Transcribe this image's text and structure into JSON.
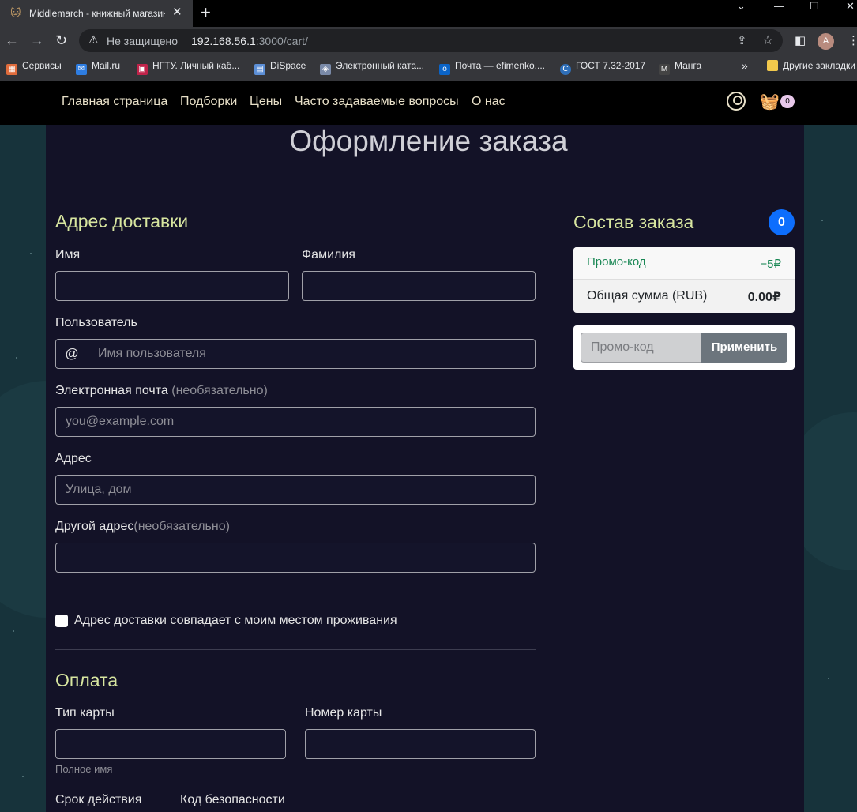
{
  "browser": {
    "tab_title": "Middlemarch - книжный магазин",
    "security_text": "Не защищено",
    "url_host": "192.168.56.1",
    "url_path": ":3000/cart/",
    "avatar_letter": "A",
    "bookmarks": [
      "Сервисы",
      "Mail.ru",
      "НГТУ. Личный каб...",
      "DiSpace",
      "Электронный ката...",
      "Почта — efimenko....",
      "ГОСТ 7.32-2017",
      "Манга",
      "Другие закладки"
    ]
  },
  "nav": {
    "links": [
      "Главная страница",
      "Подборки",
      "Цены",
      "Часто задаваемые вопросы",
      "О нас"
    ],
    "cart_count": "0"
  },
  "page": {
    "title": "Оформление заказа"
  },
  "address": {
    "heading": "Адрес доставки",
    "first_name_label": "Имя",
    "last_name_label": "Фамилия",
    "username_label": "Пользователь",
    "username_prefix": "@",
    "username_placeholder": "Имя пользователя",
    "email_label": "Электронная почта",
    "email_optional": "(необязательно)",
    "email_placeholder": "you@example.com",
    "address_label": "Адрес",
    "address_placeholder": "Улица, дом",
    "address2_label": "Другой адрес",
    "address2_optional": "(необязательно)",
    "same_address_label": "Адрес доставки совпадает с моим местом проживания"
  },
  "payment": {
    "heading": "Оплата",
    "card_type_label": "Тип карты",
    "card_type_help": "Полное имя",
    "card_number_label": "Номер карты",
    "expiry_label": "Срок действия",
    "cvv_label": "Код безопасности"
  },
  "order": {
    "heading": "Состав заказа",
    "count": "0",
    "promo_label": "Промо-код",
    "promo_value": "−5₽",
    "total_label": "Общая сумма (RUB)",
    "total_value": "0.00₽",
    "promo_placeholder": "Промо-код",
    "apply_label": "Применить"
  }
}
